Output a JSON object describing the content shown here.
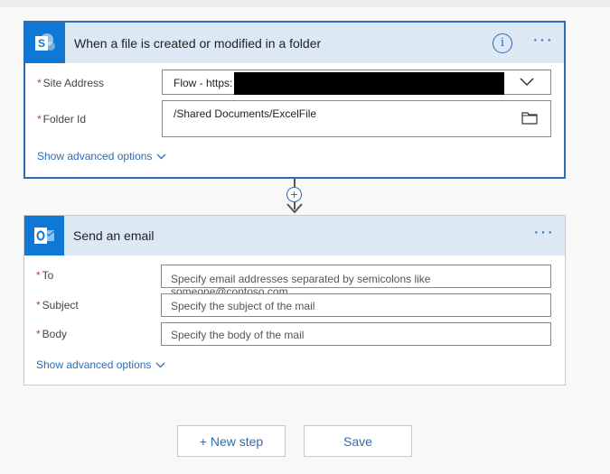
{
  "trigger": {
    "title": "When a file is created or modified in a folder",
    "info_icon": "info-icon",
    "more_icon": "ellipsis-icon",
    "fields": {
      "site_address": {
        "label": "Site Address",
        "value": "Flow - https:"
      },
      "folder_id": {
        "label": "Folder Id",
        "value": "/Shared Documents/ExcelFile"
      }
    },
    "advanced_label": "Show advanced options"
  },
  "connector": {
    "plus": "+"
  },
  "action": {
    "title": "Send an email",
    "more_icon": "ellipsis-icon",
    "fields": {
      "to": {
        "label": "To",
        "placeholder": "Specify email addresses separated by semicolons like someone@contoso.com"
      },
      "subject": {
        "label": "Subject",
        "placeholder": "Specify the subject of the mail"
      },
      "body": {
        "label": "Body",
        "placeholder": "Specify the body of the mail"
      }
    },
    "advanced_label": "Show advanced options"
  },
  "footer": {
    "new_step_label": "+ New step",
    "save_label": "Save"
  },
  "colors": {
    "accent": "#2d6cb4",
    "header_bg": "#dce9f5",
    "icon_bg": "#0f78d4",
    "required": "#d13438"
  }
}
